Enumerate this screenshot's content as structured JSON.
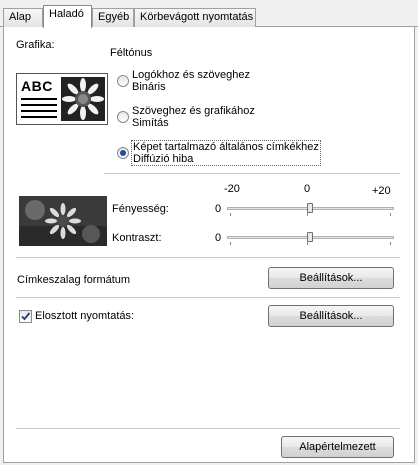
{
  "tabs": [
    {
      "label": "Alap",
      "active": false
    },
    {
      "label": "Haladó",
      "active": true
    },
    {
      "label": "Egyéb",
      "active": false
    },
    {
      "label": "Körbevágott nyomtatás",
      "active": false
    }
  ],
  "grafika": {
    "label": "Grafika:",
    "halftone_label": "Féltónus",
    "preview_text": "ABC",
    "options": [
      {
        "line1": "Logókhoz és szöveghez",
        "line2": "Bináris",
        "checked": false
      },
      {
        "line1": "Szöveghez és grafikához",
        "line2": "Simítás",
        "checked": false
      },
      {
        "line1": "Képet tartalmazó általános címkékhez",
        "line2": "Diffúzió hiba",
        "checked": true
      }
    ]
  },
  "adjust": {
    "scale_min": "-20",
    "scale_mid": "0",
    "scale_max": "+20",
    "brightness": {
      "label": "Fényesség:",
      "value": "0",
      "level": 0
    },
    "contrast": {
      "label": "Kontraszt:",
      "value": "0",
      "level": 0
    }
  },
  "tape_format": {
    "label": "Címkeszalag formátum",
    "button": "Beállítások..."
  },
  "distributed": {
    "label": "Elosztott nyomtatás:",
    "checked": true,
    "button": "Beállítások..."
  },
  "default_button": "Alapértelmezett"
}
